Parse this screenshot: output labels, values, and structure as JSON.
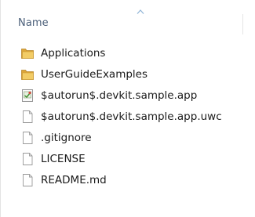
{
  "column_header": {
    "name_label": "Name",
    "sort": "ascending"
  },
  "files": [
    {
      "name": "Applications",
      "icon": "folder-icon"
    },
    {
      "name": "UserGuideExamples",
      "icon": "folder-icon"
    },
    {
      "name": "$autorun$.devkit.sample.app",
      "icon": "app-file-icon"
    },
    {
      "name": "$autorun$.devkit.sample.app.uwc",
      "icon": "blank-file-icon"
    },
    {
      "name": ".gitignore",
      "icon": "blank-file-icon"
    },
    {
      "name": "LICENSE",
      "icon": "blank-file-icon"
    },
    {
      "name": "README.md",
      "icon": "blank-file-icon"
    }
  ],
  "colors": {
    "header_text": "#4c607a",
    "sort_arrow": "#8fb4d6",
    "folder": "#e8b84a"
  }
}
